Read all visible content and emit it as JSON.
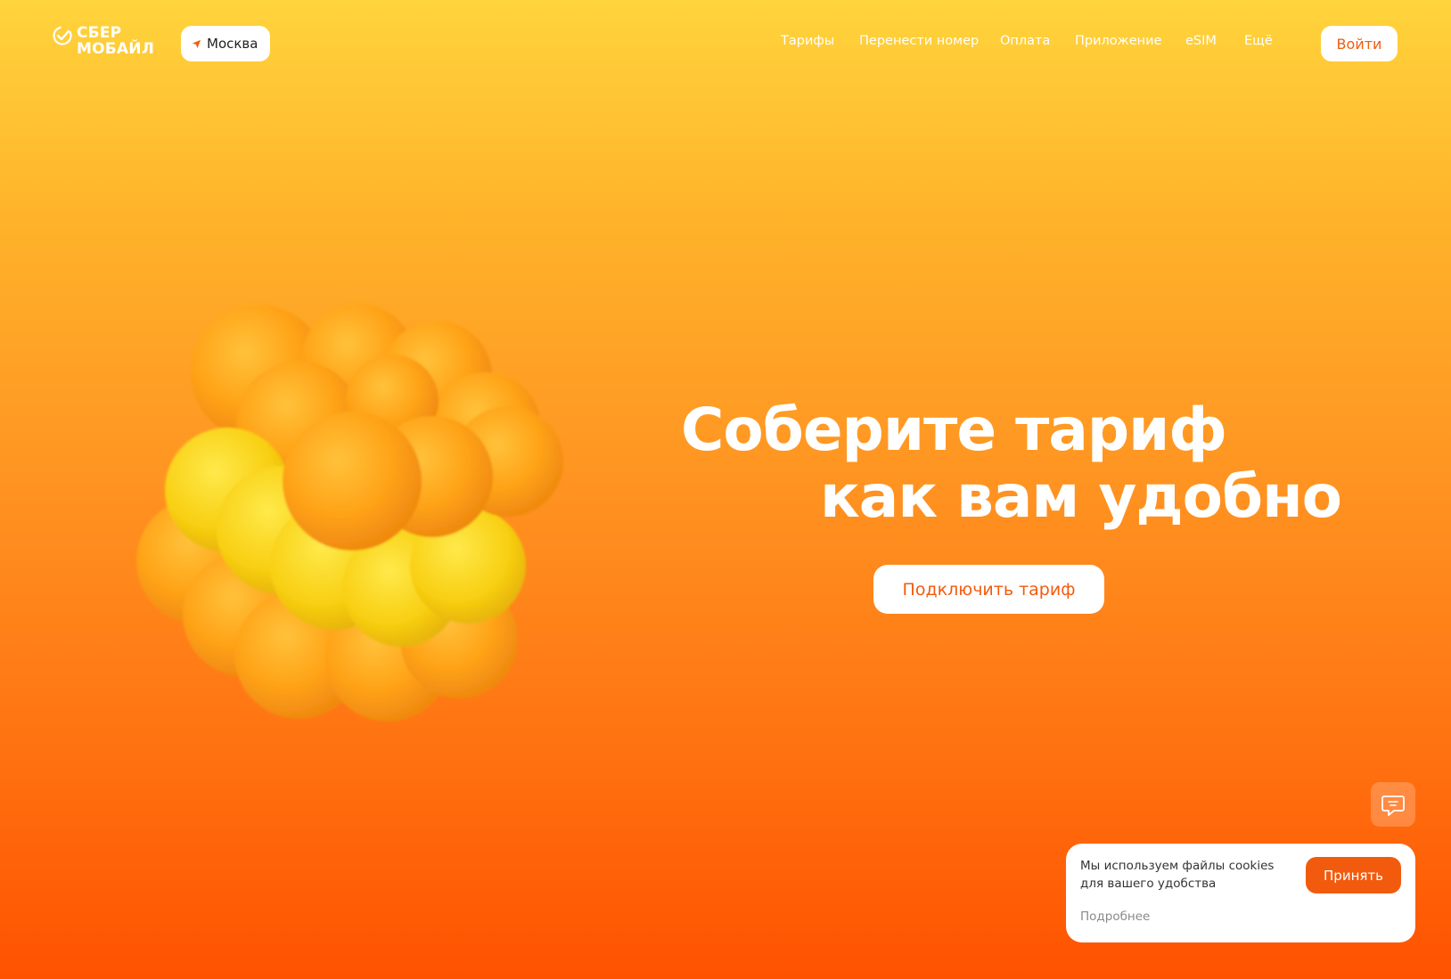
{
  "header": {
    "logo": {
      "line1": "СБЕР",
      "line2": "МОБАЙЛ",
      "icon": "sber-check-icon"
    },
    "city": {
      "label": "Москва",
      "icon": "location-arrow-icon"
    },
    "nav": [
      {
        "label": "Тарифы"
      },
      {
        "label": "Перенести номер"
      },
      {
        "label": "Оплата"
      },
      {
        "label": "Приложение"
      },
      {
        "label": "eSIM"
      },
      {
        "label": "Ещё"
      }
    ],
    "login_label": "Войти"
  },
  "hero": {
    "title_line1": "Соберите тариф",
    "title_line2": "как вам удобно",
    "cta_label": "Подключить тариф"
  },
  "chat": {
    "icon": "chat-bubble-icon"
  },
  "cookie": {
    "text": "Мы используем файлы cookies для вашего удобства",
    "more_label": "Подробнее",
    "accept_label": "Принять"
  },
  "colors": {
    "accent": "#f25b0e",
    "bg_top": "#ffd43c",
    "bg_bottom": "#ff5200"
  }
}
